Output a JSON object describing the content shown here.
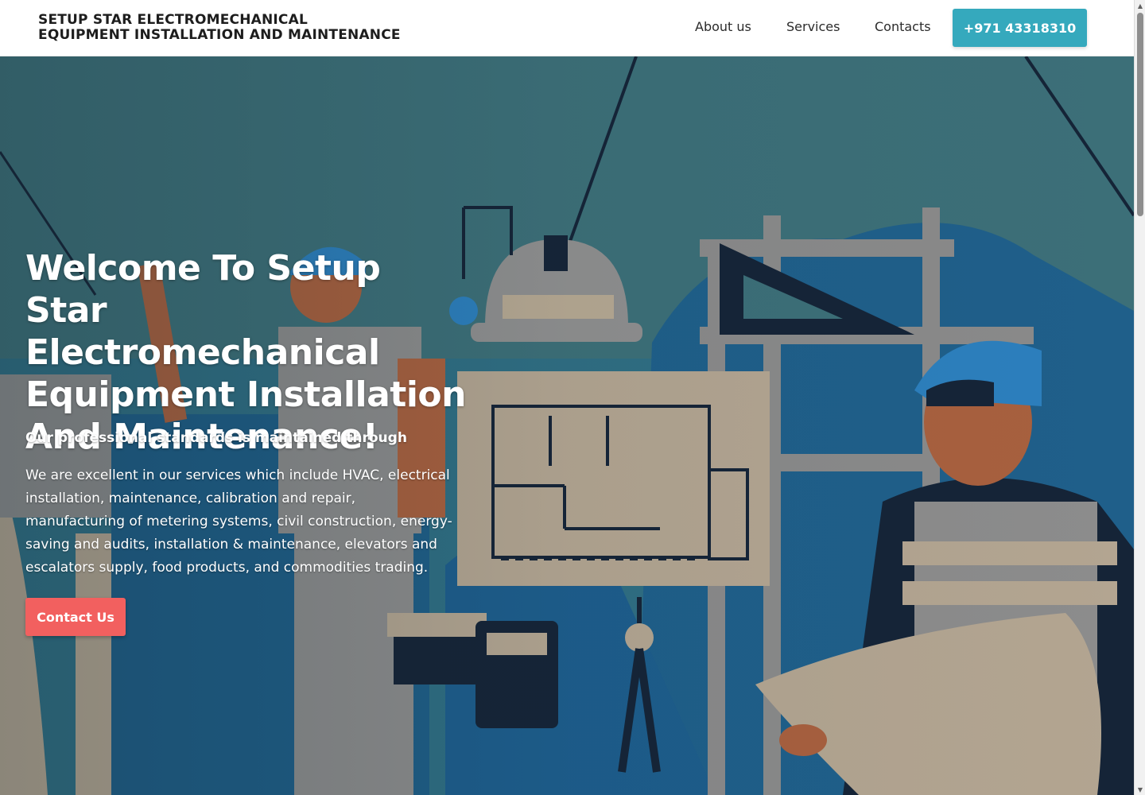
{
  "header": {
    "brand_line1": "SETUP STAR ELECTROMECHANICAL",
    "brand_line2": "EQUIPMENT INSTALLATION AND MAINTENANCE",
    "nav": [
      "About us",
      "Services",
      "Contacts"
    ],
    "phone": "+971 43318310"
  },
  "hero": {
    "title": "Welcome To Setup Star Electromechanical Equipment Installation And Maintenance!",
    "subtitle": "Our professional standards is maintained through",
    "description": "We are excellent in our services which include HVAC, electrical installation, maintenance, calibration and repair, manufacturing of metering systems, civil construction, energy-saving and audits, installation & maintenance, elevators and escalators supply, food products, and commodities trading.",
    "cta": "Contact Us"
  },
  "colors": {
    "accent_teal": "#35a9bd",
    "cta_red": "#f2605f",
    "hero_blue": "#2f6f86"
  },
  "icons": [
    "scroll-up-arrow-icon",
    "scroll-down-arrow-icon"
  ]
}
